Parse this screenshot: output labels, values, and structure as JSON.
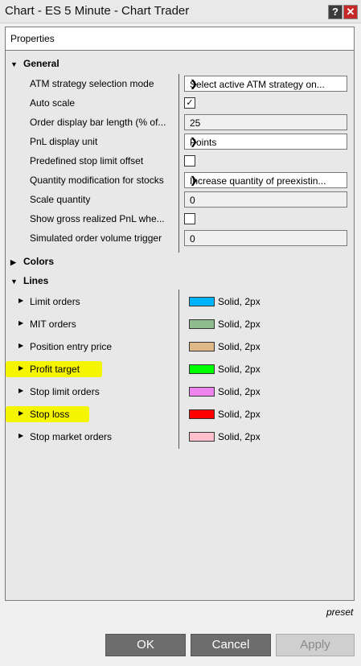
{
  "window": {
    "title": "Chart - ES 5 Minute - Chart Trader",
    "help_label": "?",
    "close_label": "✕"
  },
  "panel": {
    "header": "Properties"
  },
  "general": {
    "label": "General",
    "rows": [
      {
        "label": "ATM strategy selection mode",
        "type": "dropdown",
        "value": "Select active ATM strategy on..."
      },
      {
        "label": "Auto scale",
        "type": "checkbox",
        "checked": true
      },
      {
        "label": "Order display bar length (% of...",
        "type": "text",
        "value": "25"
      },
      {
        "label": "PnL display unit",
        "type": "dropdown",
        "value": "Points"
      },
      {
        "label": "Predefined stop limit offset",
        "type": "checkbox",
        "checked": false
      },
      {
        "label": "Quantity modification for stocks",
        "type": "dropdown",
        "value": "Increase quantity of preexistin..."
      },
      {
        "label": "Scale quantity",
        "type": "text",
        "value": "0"
      },
      {
        "label": "Show gross realized PnL whe...",
        "type": "checkbox",
        "checked": false
      },
      {
        "label": "Simulated order volume trigger",
        "type": "text",
        "value": "0"
      }
    ]
  },
  "colors": {
    "label": "Colors"
  },
  "lines": {
    "label": "Lines",
    "rows": [
      {
        "label": "Limit orders",
        "color": "#00b4ff",
        "style": "Solid, 2px"
      },
      {
        "label": "MIT orders",
        "color": "#8fbc8f",
        "style": "Solid, 2px"
      },
      {
        "label": "Position entry price",
        "color": "#deb887",
        "style": "Solid, 2px"
      },
      {
        "label": "Profit target",
        "color": "#00ff00",
        "style": "Solid, 2px"
      },
      {
        "label": "Stop limit orders",
        "color": "#ee82ee",
        "style": "Solid, 2px"
      },
      {
        "label": "Stop loss",
        "color": "#ff0000",
        "style": "Solid, 2px"
      },
      {
        "label": "Stop market orders",
        "color": "#ffc0cb",
        "style": "Solid, 2px"
      }
    ]
  },
  "footer": {
    "preset": "preset",
    "ok": "OK",
    "cancel": "Cancel",
    "apply": "Apply"
  },
  "highlight_color": "#f6f500"
}
